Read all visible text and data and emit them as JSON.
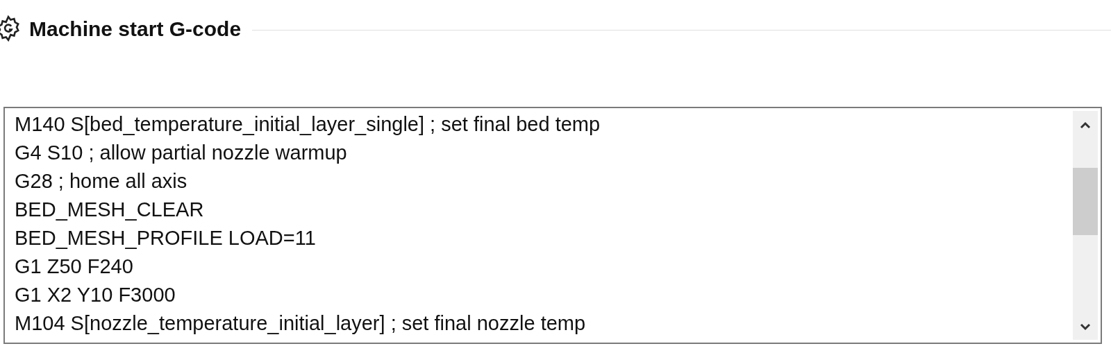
{
  "section": {
    "title": "Machine start G-code"
  },
  "editor": {
    "lines": [
      "M140 S[bed_temperature_initial_layer_single] ; set final bed temp",
      "G4 S10 ; allow partial nozzle warmup",
      "G28 ; home all axis",
      "BED_MESH_CLEAR",
      "BED_MESH_PROFILE LOAD=11",
      "G1 Z50 F240",
      "G1 X2 Y10 F3000",
      "M104 S[nozzle_temperature_initial_layer] ; set final nozzle temp"
    ]
  }
}
